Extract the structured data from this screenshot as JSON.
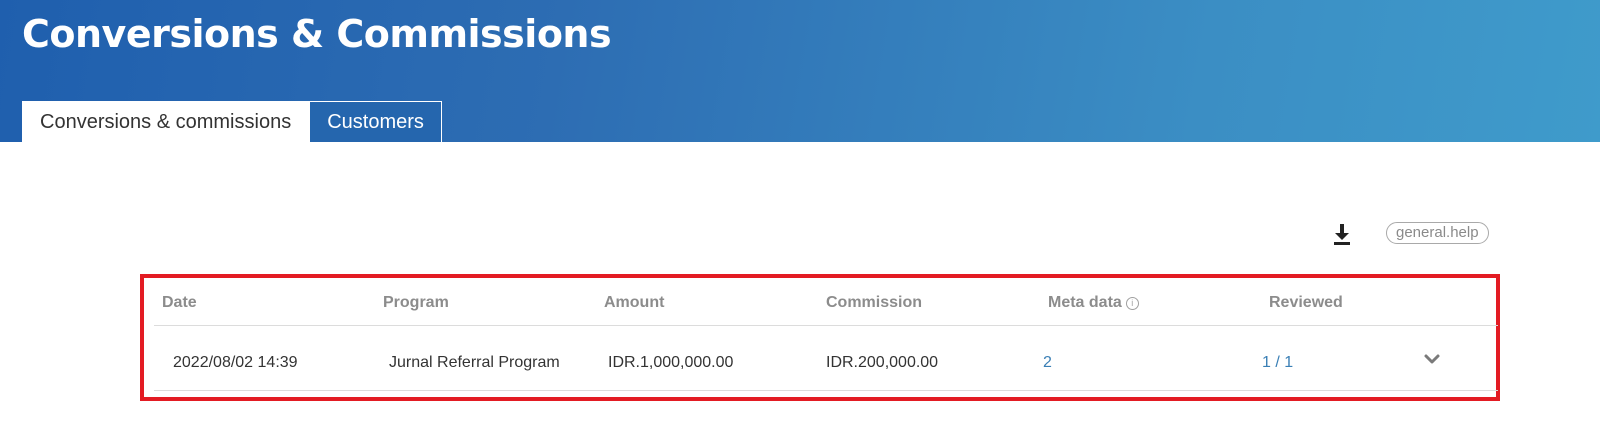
{
  "header": {
    "title": "Conversions & Commissions"
  },
  "tabs": [
    {
      "label": "Conversions & commissions",
      "active": true
    },
    {
      "label": "Customers",
      "active": false
    }
  ],
  "toolbar": {
    "download_icon": "download-icon",
    "help_label": "general.help"
  },
  "table": {
    "columns": [
      "Date",
      "Program",
      "Amount",
      "Commission",
      "Meta data",
      "Reviewed"
    ],
    "meta_info_icon": "info-icon",
    "rows": [
      {
        "date": "2022/08/02 14:39",
        "program": "Jurnal Referral Program",
        "amount": "IDR.1,000,000.00",
        "commission": "IDR.200,000.00",
        "meta_data": "2",
        "reviewed": "1 / 1",
        "expand_icon": "chevron-down-icon"
      }
    ]
  },
  "colors": {
    "header_gradient_start": "#1f5fae",
    "header_gradient_end": "#3f9bcb",
    "highlight_border": "#e31b23",
    "link": "#3a7fb5"
  }
}
